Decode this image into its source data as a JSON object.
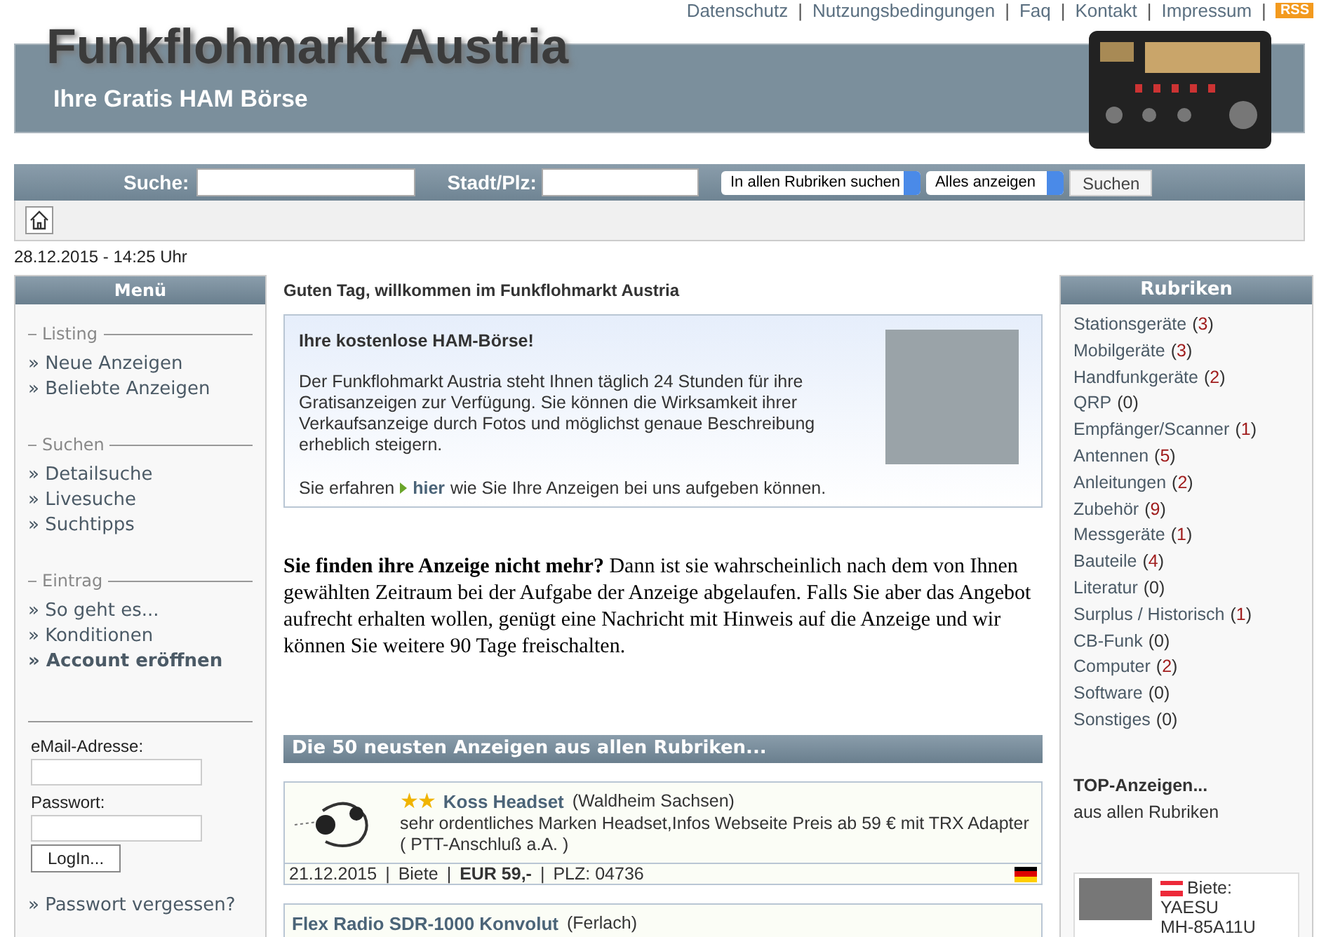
{
  "top_links": [
    {
      "kind": "link",
      "text": "Datenschutz"
    },
    {
      "kind": "separator",
      "text": "|"
    },
    {
      "kind": "link",
      "text": "Nutzungsbedingungen"
    },
    {
      "kind": "separator",
      "text": "|"
    },
    {
      "kind": "link",
      "text": "Faq"
    },
    {
      "kind": "separator",
      "text": "|"
    },
    {
      "kind": "link",
      "text": "Kontakt"
    },
    {
      "kind": "separator",
      "text": "|"
    },
    {
      "kind": "link",
      "text": "Impressum"
    },
    {
      "kind": "separator",
      "text": "|"
    }
  ],
  "rss_badge": "RSS",
  "header": {
    "title": "Funkflohmarkt Austria",
    "subtitle": "Ihre Gratis HAM Börse"
  },
  "search_bar": {
    "search_label": "Suche:",
    "city_label": "Stadt/Plz:",
    "category_select": "In allen Rubriken suchen",
    "filter_select": "Alles anzeigen",
    "button": "Suchen"
  },
  "datetime": "28.12.2015 - 14:25 Uhr",
  "menu": {
    "title": "Menü",
    "sections": [
      {
        "heading": "Listing",
        "items": [
          {
            "label": "» Neue Anzeigen",
            "bold": false
          },
          {
            "label": "» Beliebte Anzeigen",
            "bold": false
          }
        ]
      },
      {
        "heading": "Suchen",
        "items": [
          {
            "label": "» Detailsuche",
            "bold": false
          },
          {
            "label": "» Livesuche",
            "bold": false
          },
          {
            "label": "» Suchtipps",
            "bold": false
          }
        ]
      },
      {
        "heading": "Eintrag",
        "items": [
          {
            "label": "» So geht es...",
            "bold": false
          },
          {
            "label": "» Konditionen",
            "bold": false
          },
          {
            "label": "» Account eröffnen",
            "bold": true
          }
        ]
      }
    ],
    "login": {
      "email_label": "eMail-Adresse:",
      "password_label": "Passwort:",
      "button": "LogIn...",
      "forgot_link": "» Passwort vergessen?"
    }
  },
  "welcome": {
    "heading": "Guten Tag, willkommen im Funkflohmarkt Austria",
    "box_title": "Ihre kostenlose HAM-Börse!",
    "box_text": "Der Funkflohmarkt Austria steht Ihnen täglich 24 Stunden für ihre Gratisanzeigen zur Verfügung. Sie können die Wirksamkeit ihrer Verkaufsanzeige durch Fotos und möglichst genaue Beschreibung erheblich steigern.",
    "link_before": "Sie erfahren",
    "link": "hier",
    "link_after": "wie Sie Ihre Anzeigen bei uns aufgeben können."
  },
  "notice": "**Sie finden ihre Anzeige nicht mehr?** Dann ist sie wahrscheinlich nach dem von Ihnen gewählten Zeitraum bei der Aufgabe der Anzeige abgelaufen. Falls Sie aber das Angebot aufrecht erhalten wollen, genügt eine Nachricht mit Hinweis auf die Anzeige und wir können Sie weitere 90 Tage freischalten.",
  "listings_title": "Die 50 neusten Anzeigen aus allen Rubriken...",
  "listings": [
    {
      "badge": "★★",
      "title": "Koss Headset",
      "location": "(Waldheim Sachsen)",
      "description": "sehr ordentliches Marken Headset,Infos Webseite Preis ab 59 € mit TRX Adapter ( PTT-Anschluß a.A. )",
      "meta": [
        {
          "text": "21.12.2015",
          "bold": false
        },
        {
          "text": "|",
          "bold": false
        },
        {
          "text": "Biete",
          "bold": false
        },
        {
          "text": "|",
          "bold": false
        },
        {
          "text": "EUR 59,-",
          "bold": true
        },
        {
          "text": "|",
          "bold": false
        },
        {
          "text": "PLZ: 04736",
          "bold": false
        }
      ],
      "flag": {
        "kind": "de"
      }
    },
    {
      "title": "Flex Radio SDR-1000 Konvolut",
      "location": "(Ferlach)"
    }
  ],
  "categories": {
    "title": "Rubriken",
    "items": [
      {
        "name": "Stationsgeräte",
        "count": "(3)",
        "highlight": true
      },
      {
        "name": "Mobilgeräte",
        "count": "(3)",
        "highlight": true
      },
      {
        "name": "Handfunkgeräte",
        "count": "(2)",
        "highlight": true
      },
      {
        "name": "QRP",
        "count": "(0)",
        "highlight": false
      },
      {
        "name": "Empfänger/Scanner",
        "count": "(1)",
        "highlight": true
      },
      {
        "name": "Antennen",
        "count": "(5)",
        "highlight": true
      },
      {
        "name": "Anleitungen",
        "count": "(2)",
        "highlight": true
      },
      {
        "name": "Zubehör",
        "count": "(9)",
        "highlight": true
      },
      {
        "name": "Messgeräte",
        "count": "(1)",
        "highlight": true
      },
      {
        "name": "Bauteile",
        "count": "(4)",
        "highlight": true
      },
      {
        "name": "Literatur",
        "count": "(0)",
        "highlight": false
      },
      {
        "name": "Surplus / Historisch",
        "count": "(1)",
        "highlight": true
      },
      {
        "name": "CB-Funk",
        "count": "(0)",
        "highlight": false
      },
      {
        "name": "Computer",
        "count": "(2)",
        "highlight": true
      },
      {
        "name": "Software",
        "count": "(0)",
        "highlight": false
      },
      {
        "name": "Sonstiges",
        "count": "(0)",
        "highlight": false
      }
    ]
  },
  "top_ads": {
    "title": "TOP-Anzeigen...",
    "subtitle": "aus allen Rubriken",
    "items": [
      {
        "flag": {
          "kind": "at"
        },
        "type": "Biete:",
        "title_lines": [
          "YAESU",
          "MH-85A11U"
        ]
      }
    ]
  }
}
